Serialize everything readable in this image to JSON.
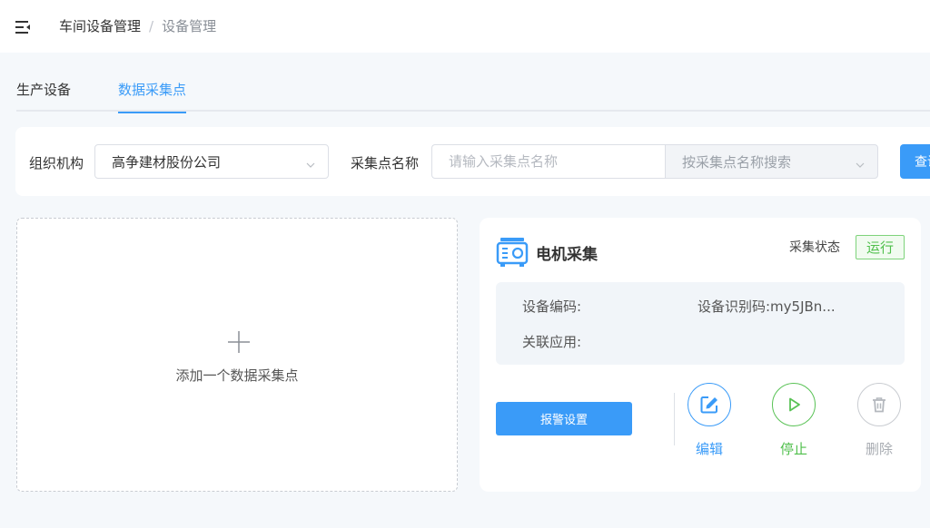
{
  "header": {
    "menu_icon": "menu-fold-icon",
    "breadcrumb": [
      "车间设备管理",
      "设备管理"
    ],
    "separator": "/"
  },
  "tabs": [
    {
      "label": "生产设备",
      "active": false
    },
    {
      "label": "数据采集点",
      "active": true
    }
  ],
  "filters": {
    "org_label": "组织机构",
    "org_value": "高争建材股份公司",
    "name_label": "采集点名称",
    "name_placeholder": "请输入采集点名称",
    "search_mode": "按采集点名称搜索",
    "query_button": "查询"
  },
  "add_card": {
    "icon": "plus-icon",
    "label": "添加一个数据采集点"
  },
  "device": {
    "icon": "generator-icon",
    "title": "电机采集",
    "status_label": "采集状态",
    "status_value": "运行",
    "code_label": "设备编码:",
    "identifier": "设备识别码:my5JBn...",
    "app_label": "关联应用:",
    "alarm_button": "报警设置",
    "actions": {
      "edit": "编辑",
      "stop": "停止",
      "delete": "删除"
    }
  },
  "colors": {
    "accent": "#3a9bf8",
    "running": "#4fbf4b",
    "disabled": "#a8acb2"
  }
}
